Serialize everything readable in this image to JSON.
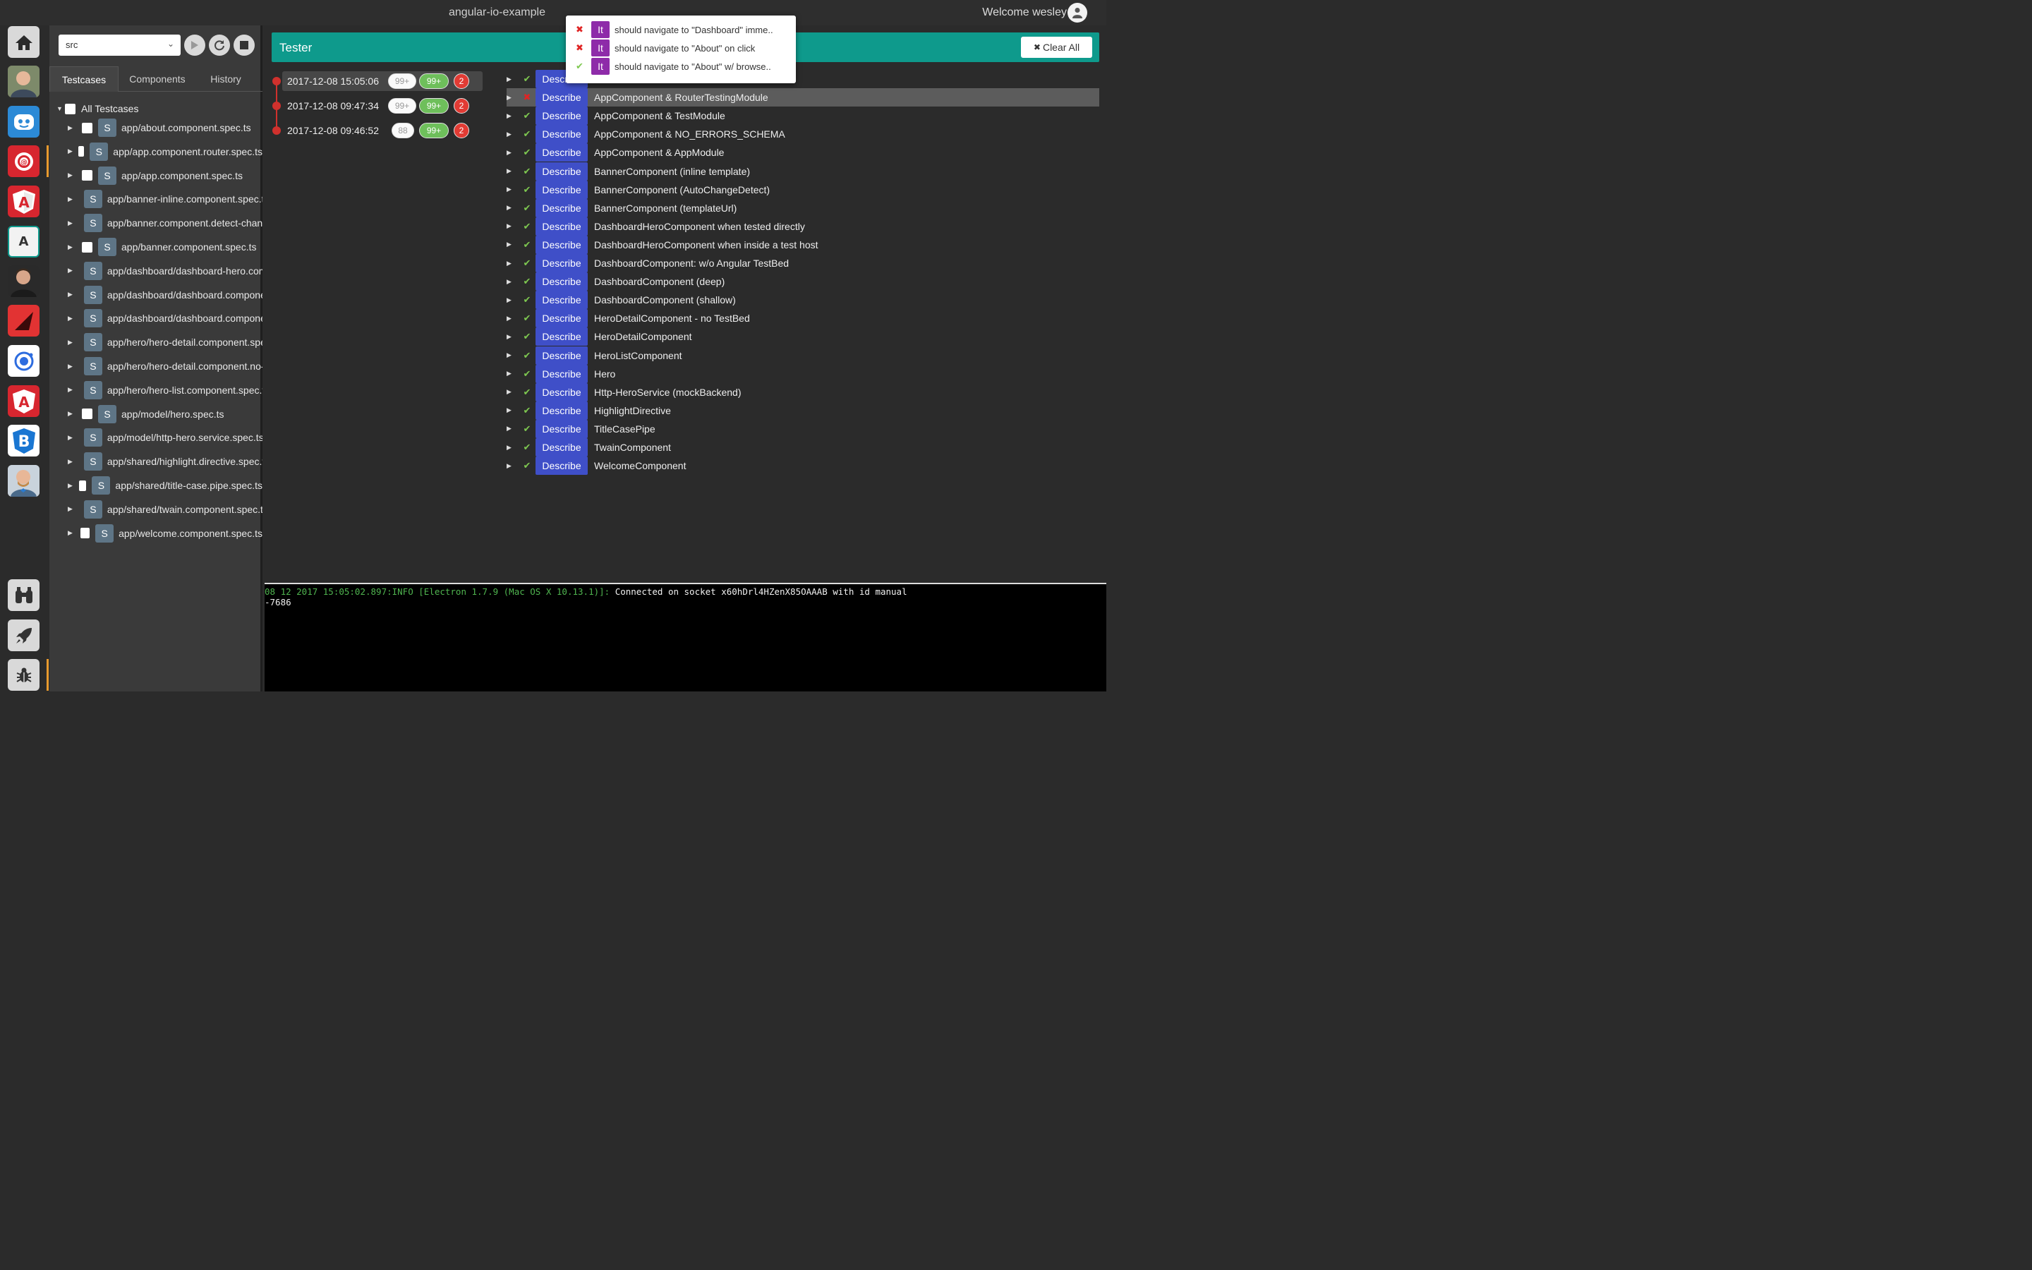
{
  "app": {
    "title": "angular-io-example",
    "welcome": "Welcome wesley"
  },
  "colors": {
    "accent": "#0e9a8c",
    "describe": "#3f4fc8",
    "it": "#8e2ba9",
    "pass": "#7ec850",
    "fail": "#e02424"
  },
  "rail": {
    "items": [
      {
        "name": "home-icon",
        "letter": "",
        "bg": "#d9d9d9"
      },
      {
        "name": "avatar-1-icon",
        "letter": "",
        "bg": "#8a7a63"
      },
      {
        "name": "robot-icon",
        "letter": "",
        "bg": "#2c8ad6"
      },
      {
        "name": "at-target-icon",
        "letter": "@",
        "bg": "#d7262f"
      },
      {
        "name": "angular-icon",
        "letter": "A",
        "bg": "#d7262f"
      },
      {
        "name": "a-box-icon",
        "letter": "A",
        "bg": "#f2f2f2"
      },
      {
        "name": "avatar-2-icon",
        "letter": "",
        "bg": "#3a3a3a"
      },
      {
        "name": "triangle-logo-icon",
        "letter": "",
        "bg": "#e23333"
      },
      {
        "name": "ring-logo-icon",
        "letter": "",
        "bg": "#ffffff"
      },
      {
        "name": "angular-shield-icon",
        "letter": "A",
        "bg": "#d7262f"
      },
      {
        "name": "bootstrap-b-icon",
        "letter": "B",
        "bg": "#ffffff"
      },
      {
        "name": "avatar-3-icon",
        "letter": "",
        "bg": "#aab7c4"
      }
    ],
    "bottom": [
      {
        "name": "binoculars-icon"
      },
      {
        "name": "rocket-icon"
      },
      {
        "name": "bug-icon"
      }
    ]
  },
  "left": {
    "select_value": "src",
    "tabs": [
      "Testcases",
      "Components",
      "History"
    ],
    "root_label": "All Testcases",
    "items": [
      "app/about.component.spec.ts",
      "app/app.component.router.spec.ts",
      "app/app.component.spec.ts",
      "app/banner-inline.component.spec.ts",
      "app/banner.component.detect-changes.spec.ts",
      "app/banner.component.spec.ts",
      "app/dashboard/dashboard-hero.component.spec.ts",
      "app/dashboard/dashboard.component.spec.ts",
      "app/dashboard/dashboard.component.no-testbed.spec.ts",
      "app/hero/hero-detail.component.spec.ts",
      "app/hero/hero-detail.component.no-testbed.spec.ts",
      "app/hero/hero-list.component.spec.ts",
      "app/model/hero.spec.ts",
      "app/model/http-hero.service.spec.ts",
      "app/shared/highlight.directive.spec.ts",
      "app/shared/title-case.pipe.spec.ts",
      "app/shared/twain.component.spec.ts",
      "app/welcome.component.spec.ts"
    ]
  },
  "tester": {
    "title": "Tester",
    "clear_all": "Clear All",
    "runs": [
      {
        "time": "2017-12-08 15:05:06",
        "a": "99+",
        "b": "99+",
        "c": "2"
      },
      {
        "time": "2017-12-08 09:47:34",
        "a": "99+",
        "b": "99+",
        "c": "2"
      },
      {
        "time": "2017-12-08 09:46:52",
        "a": "88",
        "b": "99+",
        "c": "2"
      }
    ],
    "describe_label": "Describe",
    "describes": [
      {
        "name": "",
        "status": "ok"
      },
      {
        "name": "AppComponent & RouterTestingModule",
        "status": "fail"
      },
      {
        "name": "AppComponent & TestModule",
        "status": "ok"
      },
      {
        "name": "AppComponent & NO_ERRORS_SCHEMA",
        "status": "ok"
      },
      {
        "name": "AppComponent & AppModule",
        "status": "ok"
      },
      {
        "name": "BannerComponent (inline template)",
        "status": "ok"
      },
      {
        "name": "BannerComponent (AutoChangeDetect)",
        "status": "ok"
      },
      {
        "name": "BannerComponent (templateUrl)",
        "status": "ok"
      },
      {
        "name": "DashboardHeroComponent when tested directly",
        "status": "ok"
      },
      {
        "name": "DashboardHeroComponent when inside a test host",
        "status": "ok"
      },
      {
        "name": "DashboardComponent: w/o Angular TestBed",
        "status": "ok"
      },
      {
        "name": "DashboardComponent (deep)",
        "status": "ok"
      },
      {
        "name": "DashboardComponent (shallow)",
        "status": "ok"
      },
      {
        "name": "HeroDetailComponent - no TestBed",
        "status": "ok"
      },
      {
        "name": "HeroDetailComponent",
        "status": "ok"
      },
      {
        "name": "HeroListComponent",
        "status": "ok"
      },
      {
        "name": "Hero",
        "status": "ok"
      },
      {
        "name": "Http-HeroService (mockBackend)",
        "status": "ok"
      },
      {
        "name": "HighlightDirective",
        "status": "ok"
      },
      {
        "name": "TitleCasePipe",
        "status": "ok"
      },
      {
        "name": "TwainComponent",
        "status": "ok"
      },
      {
        "name": "WelcomeComponent",
        "status": "ok"
      }
    ]
  },
  "popup": {
    "it_label": "It",
    "items": [
      {
        "text": "should navigate to \"Dashboard\" imme..",
        "status": "fail"
      },
      {
        "text": "should navigate to \"About\" on click",
        "status": "fail"
      },
      {
        "text": "should navigate to \"About\" w/ browse..",
        "status": "ok"
      }
    ]
  },
  "console": {
    "prefix": "08 12 2017 15:05:02.897:INFO [Electron 1.7.9 (Mac OS X 10.13.1)]:",
    "message": " Connected on socket x60hDrl4HZenX85OAAAB with id manual",
    "message2": "-7686"
  }
}
